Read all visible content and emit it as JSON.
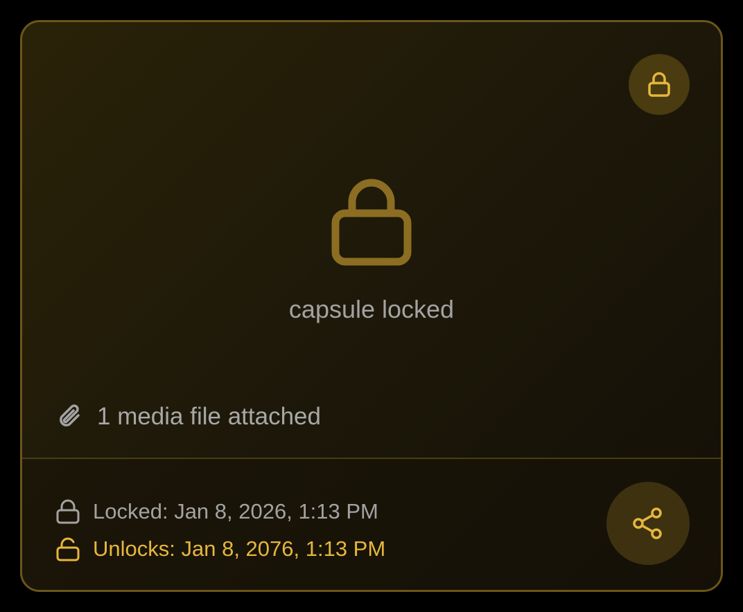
{
  "card": {
    "status_text": "capsule locked",
    "media_text": "1 media file attached",
    "locked_text": "Locked: Jan 8, 2026, 1:13 PM",
    "unlocks_text": "Unlocks: Jan 8, 2076, 1:13 PM"
  },
  "icons": {
    "corner": "lock-icon",
    "center": "lock-icon",
    "media": "paperclip-icon",
    "locked": "lock-icon",
    "unlocks": "unlock-icon",
    "share": "share-icon"
  },
  "colors": {
    "accent": "#e6b73d",
    "accent_dim": "#8c6d22",
    "muted_text": "#a3a3a3",
    "border": "#6b5619",
    "background": "#000000"
  }
}
